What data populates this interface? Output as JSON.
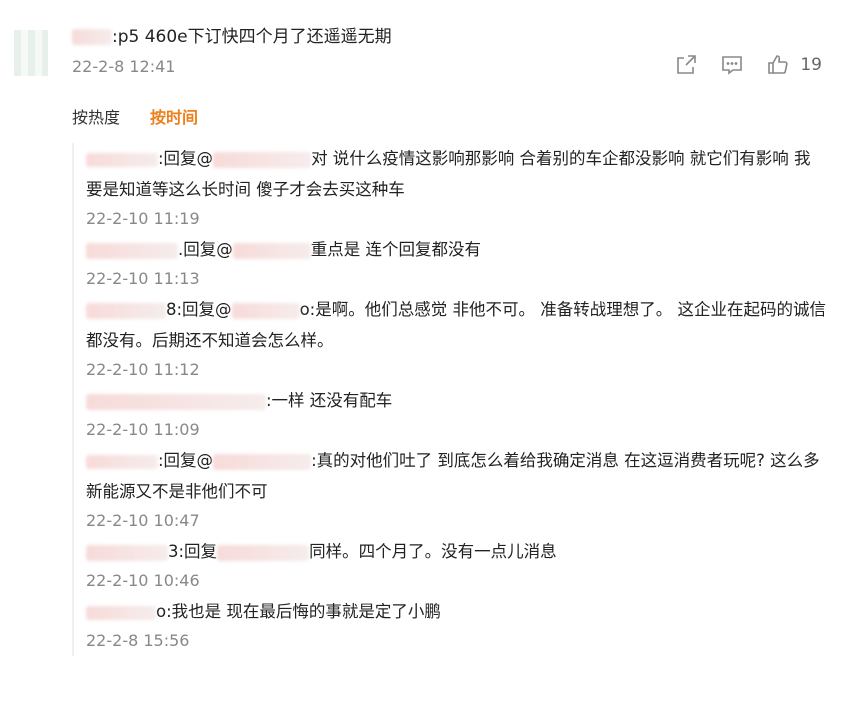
{
  "comment": {
    "text": ":p5 460e下订快四个月了还遥遥无期",
    "time": "22-2-8 12:41",
    "likes": "19"
  },
  "sort_tabs": [
    {
      "label": "按热度",
      "active": false
    },
    {
      "label": "按时间",
      "active": true
    }
  ],
  "replies": [
    {
      "segments": [
        ":回复@",
        "对  说什么疫情这影响那影响  合着别的车企都没影响  就它们有影响   我要是知道等这么长时间    傻子才会去买这种车"
      ],
      "time": "22-2-10 11:19"
    },
    {
      "segments": [
        ".回复@",
        "重点是 连个回复都没有"
      ],
      "time": "22-2-10 11:13"
    },
    {
      "segments": [
        "8:回复@",
        "o:是啊。他们总感觉 非他不可。 准备转战理想了。   这企业在起码的诚信都没有。后期还不知道会怎么样。"
      ],
      "time": "22-2-10 11:12"
    },
    {
      "segments": [
        ":一样 还没有配车"
      ],
      "time": "22-2-10 11:09"
    },
    {
      "segments": [
        ":回复@",
        ":真的对他们吐了    到底怎么着给我确定消息   在这逗消费者玩呢?   这么多新能源又不是非他们不可"
      ],
      "time": "22-2-10 10:47"
    },
    {
      "segments": [
        "3:回复",
        "同样。四个月了。没有一点儿消息"
      ],
      "time": "22-2-10 10:46"
    },
    {
      "segments": [
        "o:我也是  现在最后悔的事就是定了小鹏"
      ],
      "time": "22-2-8 15:56"
    }
  ]
}
